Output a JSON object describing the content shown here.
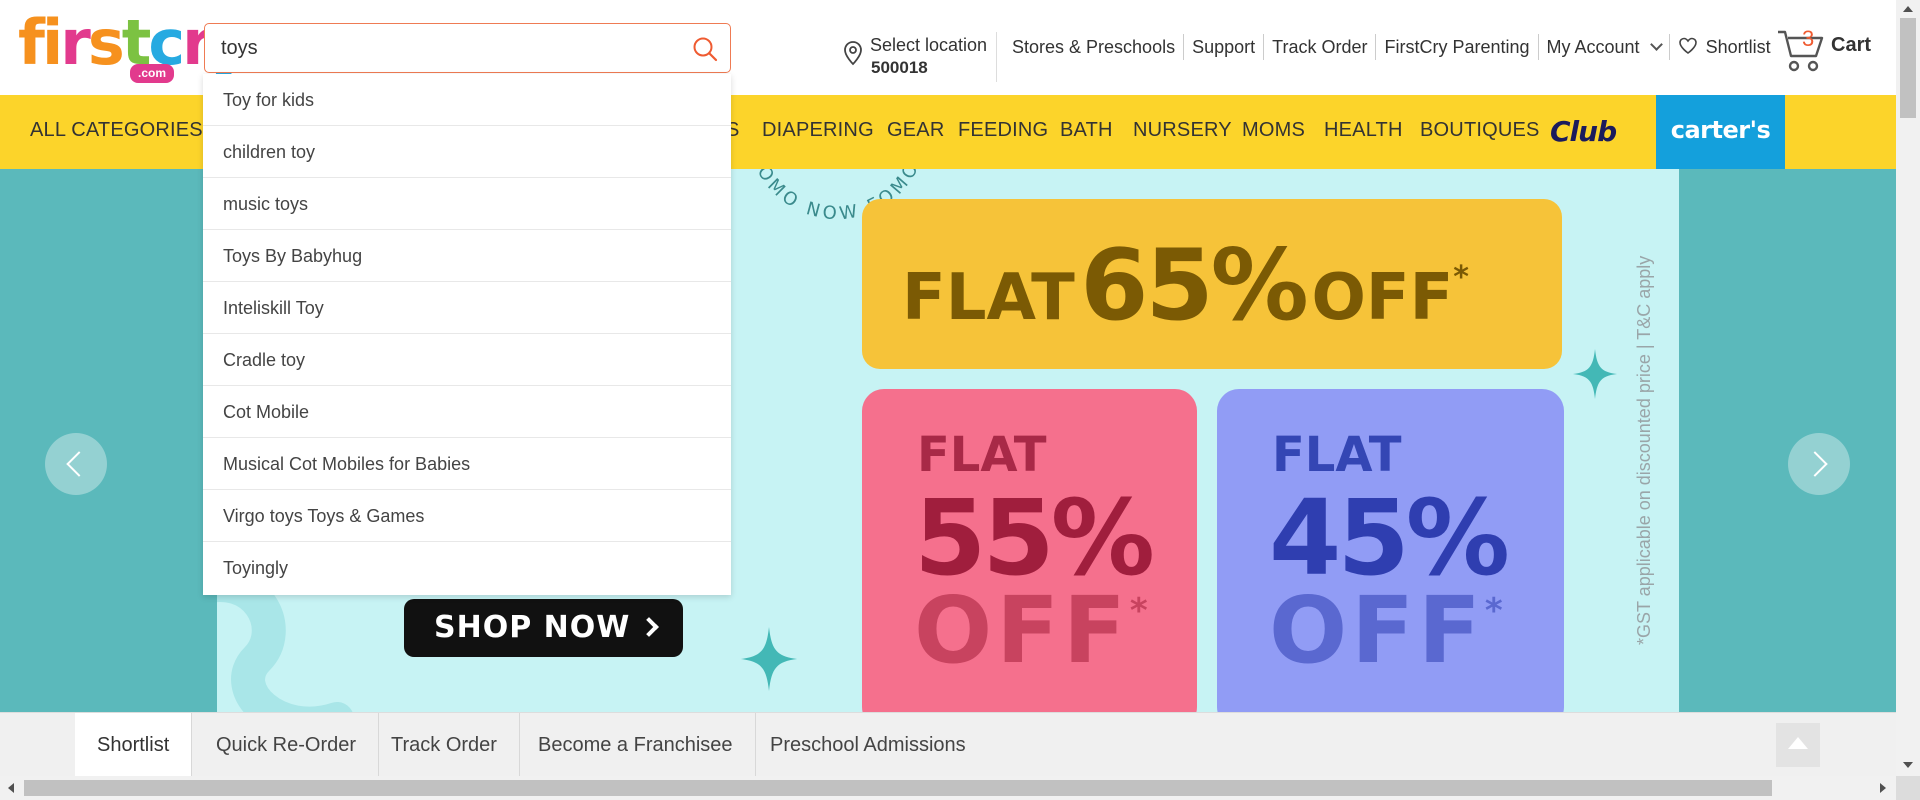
{
  "header": {
    "logo": {
      "text": "firstcry",
      "sub": ".com",
      "colors": [
        "#f6911e",
        "#e23a8d",
        "#7cc242",
        "#27aae1"
      ]
    },
    "search": {
      "value": "toys",
      "icon": "search-icon"
    },
    "location": {
      "label": "Select location",
      "pincode": "500018"
    },
    "links": [
      "Stores & Preschools",
      "Support",
      "Track Order",
      "FirstCry Parenting",
      "My Account",
      "Shortlist"
    ],
    "cart": {
      "count": "3",
      "label": "Cart"
    },
    "accent": "#ef5b31"
  },
  "categories": {
    "items": [
      "ALL CATEGORIES",
      "S",
      "DIAPERING",
      "GEAR",
      "FEEDING",
      "BATH",
      "NURSERY",
      "MOMS",
      "HEALTH",
      "BOUTIQUES"
    ],
    "club": "Club",
    "carters": "carter's",
    "bar_color": "#fcd42a"
  },
  "suggestions": [
    "Toy for kids",
    "children toy",
    "music toys",
    "Toys By Babyhug",
    "Inteliskill Toy",
    "Cradle toy",
    "Cot Mobile",
    "Musical Cot Mobiles for Babies",
    "Virgo toys Toys & Games",
    "Toyingly"
  ],
  "banner": {
    "arc_text": "# FOMO NOW FOMO # NOW FOMO",
    "flat_top": "FLAT",
    "offer_top_pct": "65%",
    "off_top": "OFF",
    "star": "*",
    "left_flat": "FLAT",
    "left_pct": "55%",
    "left_off": "OFF",
    "right_flat": "FLAT",
    "right_pct": "45%",
    "right_off": "OFF",
    "gst_note": "*GST applicable on discounted price | T&C apply",
    "cta": "SHOP NOW",
    "bg_color": "#5bb9bb"
  },
  "bottom_bar": {
    "items": [
      "Shortlist",
      "Quick Re-Order",
      "Track Order",
      "Become a Franchisee",
      "Preschool Admissions"
    ]
  }
}
